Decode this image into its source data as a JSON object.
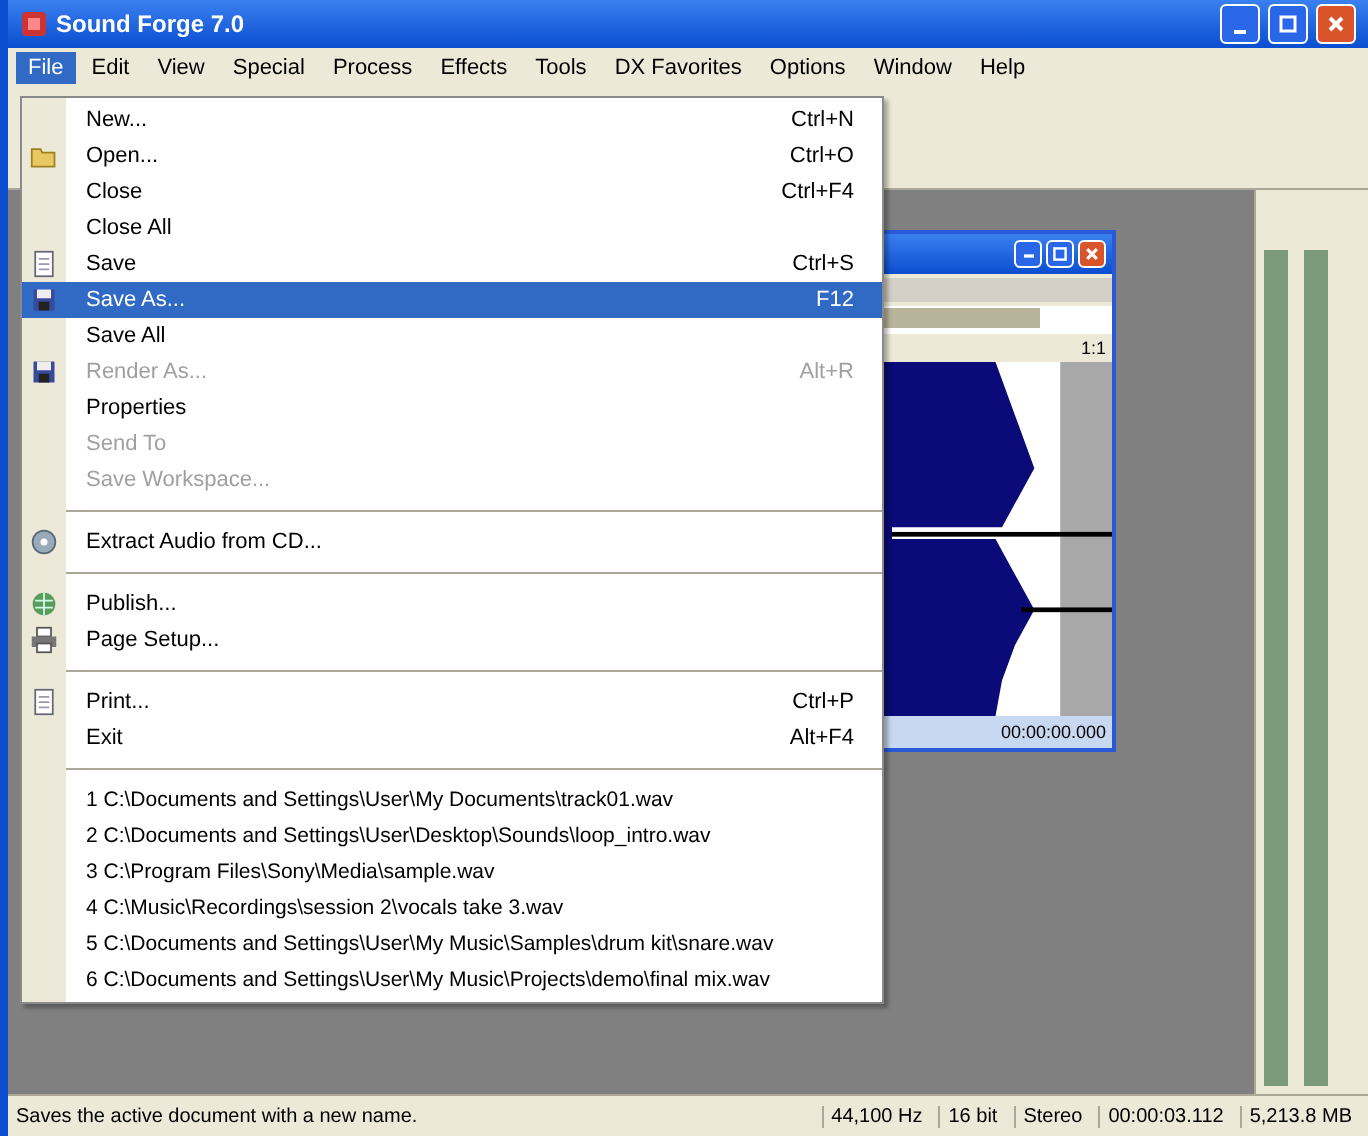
{
  "window": {
    "title": "Sound Forge 7.0"
  },
  "menubar": [
    {
      "label": "File",
      "selected": true
    },
    {
      "label": "Edit",
      "selected": false
    },
    {
      "label": "View",
      "selected": false
    },
    {
      "label": "Special",
      "selected": false
    },
    {
      "label": "Process",
      "selected": false
    },
    {
      "label": "Effects",
      "selected": false
    },
    {
      "label": "Tools",
      "selected": false
    },
    {
      "label": "DX Favorites",
      "selected": false
    },
    {
      "label": "Options",
      "selected": false
    },
    {
      "label": "Window",
      "selected": false
    },
    {
      "label": "Help",
      "selected": false
    }
  ],
  "file_menu": [
    {
      "kind": "item",
      "label": "New...",
      "shortcut": "Ctrl+N",
      "disabled": false,
      "selected": false
    },
    {
      "kind": "item",
      "label": "Open...",
      "shortcut": "Ctrl+O",
      "disabled": false,
      "selected": false
    },
    {
      "kind": "item",
      "label": "Close",
      "shortcut": "Ctrl+F4",
      "disabled": false,
      "selected": false
    },
    {
      "kind": "item",
      "label": "Close All",
      "disabled": false,
      "selected": false
    },
    {
      "kind": "item",
      "label": "Save",
      "shortcut": "Ctrl+S",
      "disabled": false,
      "selected": false
    },
    {
      "kind": "item",
      "label": "Save As...",
      "shortcut": "F12",
      "disabled": false,
      "selected": true
    },
    {
      "kind": "item",
      "label": "Save All",
      "disabled": false,
      "selected": false
    },
    {
      "kind": "item",
      "label": "Render As...",
      "shortcut": "Alt+R",
      "disabled": true,
      "selected": false
    },
    {
      "kind": "item",
      "label": "Properties",
      "disabled": false,
      "selected": false
    },
    {
      "kind": "item",
      "label": "Send To",
      "disabled": true,
      "selected": false
    },
    {
      "kind": "item",
      "label": "Save Workspace...",
      "disabled": true,
      "selected": false
    },
    {
      "kind": "separator"
    },
    {
      "kind": "item",
      "label": "Extract Audio from CD...",
      "disabled": false,
      "selected": false
    },
    {
      "kind": "separator"
    },
    {
      "kind": "item",
      "label": "Publish...",
      "disabled": false,
      "selected": false
    },
    {
      "kind": "item",
      "label": "Page Setup...",
      "disabled": false,
      "selected": false
    },
    {
      "kind": "separator"
    },
    {
      "kind": "item",
      "label": "Print...",
      "shortcut": "Ctrl+P",
      "disabled": false,
      "selected": false
    },
    {
      "kind": "item",
      "label": "Exit",
      "shortcut": "Alt+F4",
      "disabled": false,
      "selected": false
    },
    {
      "kind": "separator"
    },
    {
      "kind": "recent",
      "label": "1 C:\\Documents and Settings\\User\\My Documents\\track01.wav"
    },
    {
      "kind": "recent",
      "label": "2 C:\\Documents and Settings\\User\\Desktop\\Sounds\\loop_intro.wav"
    },
    {
      "kind": "recent",
      "label": "3 C:\\Program Files\\Sony\\Media\\sample.wav"
    },
    {
      "kind": "recent",
      "label": "4 C:\\Music\\Recordings\\session 2\\vocals take 3.wav"
    },
    {
      "kind": "recent",
      "label": "5 C:\\Documents and Settings\\User\\My Music\\Samples\\drum kit\\snare.wav"
    },
    {
      "kind": "recent",
      "label": "6 C:\\Documents and Settings\\User\\My Music\\Projects\\demo\\final mix.wav"
    }
  ],
  "data_window": {
    "ruler": "00:00:00.000",
    "scale": "1:1"
  },
  "status_bar": {
    "message": "Saves the active document with a new name.",
    "cells": [
      "44,100 Hz",
      "16 bit",
      "Stereo",
      "00:00:03.112",
      "5,213.8 MB"
    ]
  }
}
